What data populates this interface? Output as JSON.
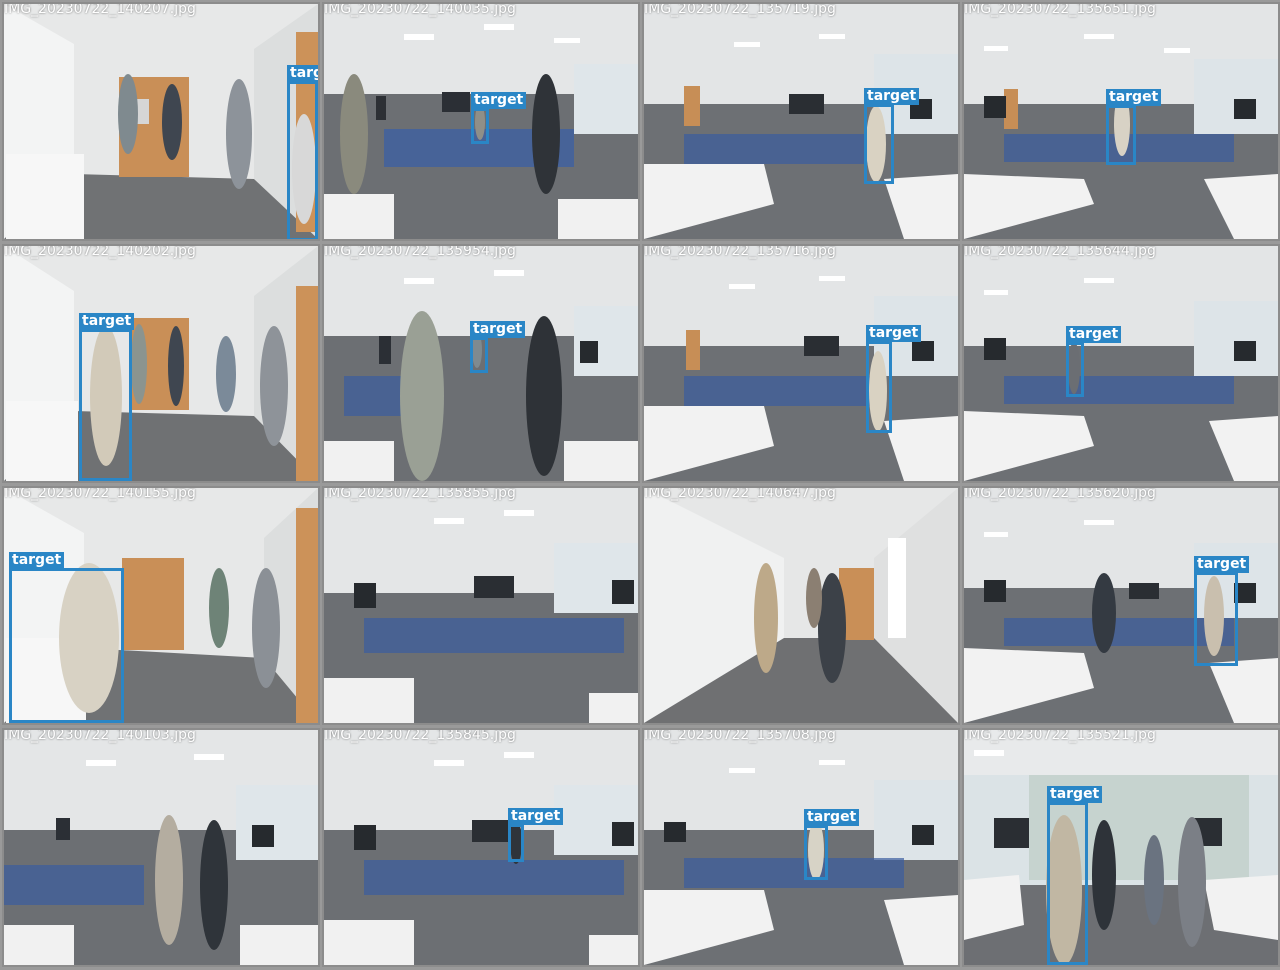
{
  "colors": {
    "bbox": "#2a86c6",
    "label_text": "#ffffff",
    "separator": "#9a9a9a"
  },
  "tiles": [
    {
      "filename": "IMG_20230722_140207.jpg",
      "scene": "corridor",
      "bbox_label": "target"
    },
    {
      "filename": "IMG_20230722_140035.jpg",
      "scene": "classroom",
      "bbox_label": "target"
    },
    {
      "filename": "IMG_20230722_135719.jpg",
      "scene": "classroom-wide",
      "bbox_label": "target"
    },
    {
      "filename": "IMG_20230722_135651.jpg",
      "scene": "classroom-wide",
      "bbox_label": "target"
    },
    {
      "filename": "IMG_20230722_140202.jpg",
      "scene": "corridor",
      "bbox_label": "target"
    },
    {
      "filename": "IMG_20230722_135954.jpg",
      "scene": "classroom",
      "bbox_label": "target"
    },
    {
      "filename": "IMG_20230722_135716.jpg",
      "scene": "classroom-wide",
      "bbox_label": "target"
    },
    {
      "filename": "IMG_20230722_135644.jpg",
      "scene": "classroom-wide",
      "bbox_label": "target"
    },
    {
      "filename": "IMG_20230722_140155.jpg",
      "scene": "corridor",
      "bbox_label": "target"
    },
    {
      "filename": "IMG_20230722_135855.jpg",
      "scene": "classroom"
    },
    {
      "filename": "IMG_20230722_140647.jpg",
      "scene": "corridor-long"
    },
    {
      "filename": "IMG_20230722_135620.jpg",
      "scene": "classroom-wide",
      "bbox_label": "target"
    },
    {
      "filename": "IMG_20230722_140103.jpg",
      "scene": "classroom"
    },
    {
      "filename": "IMG_20230722_135845.jpg",
      "scene": "classroom",
      "bbox_label": "target"
    },
    {
      "filename": "IMG_20230722_135708.jpg",
      "scene": "classroom-wide",
      "bbox_label": "target"
    },
    {
      "filename": "IMG_20230722_135521.jpg",
      "scene": "window-room",
      "bbox_label": "target"
    }
  ]
}
